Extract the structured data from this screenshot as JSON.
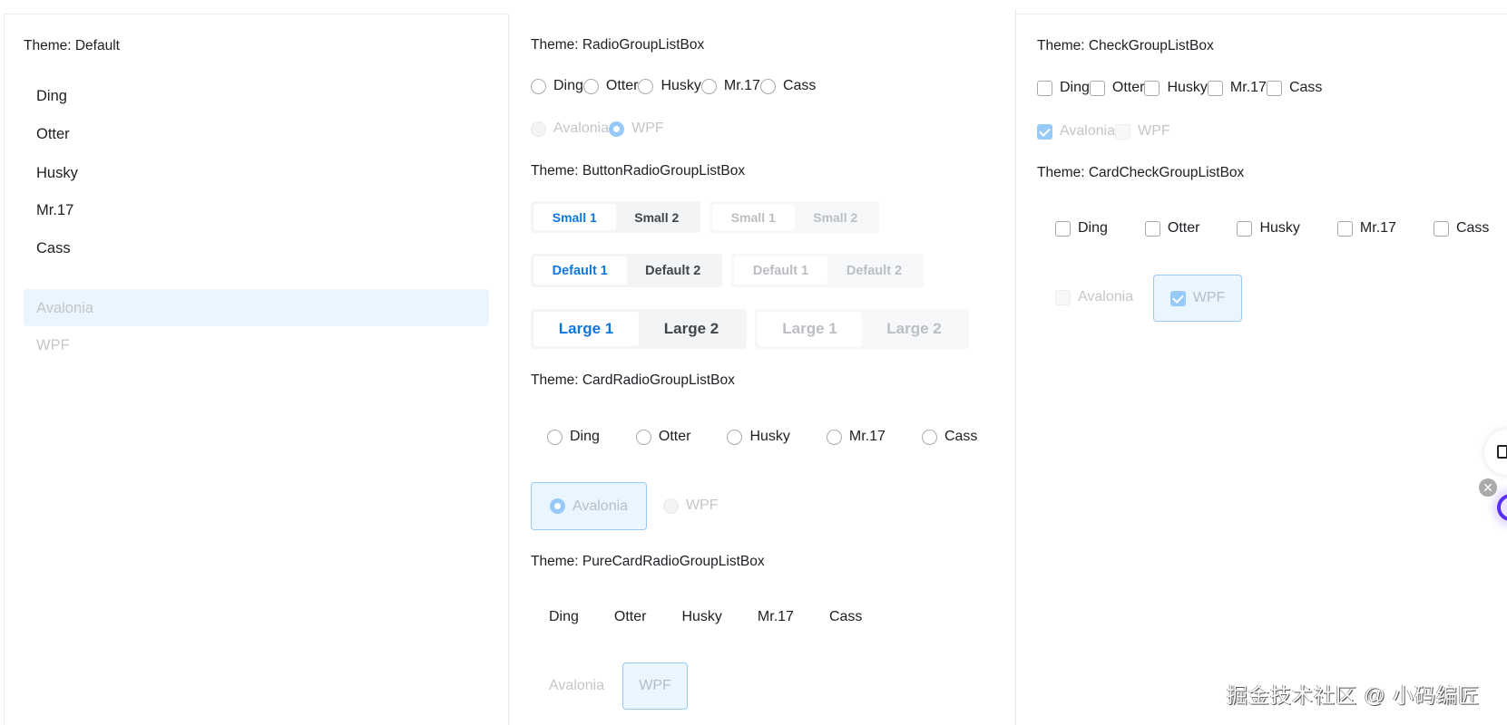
{
  "default": {
    "title": "Theme: Default",
    "items": [
      "Ding",
      "Otter",
      "Husky",
      "Mr.17",
      "Cass"
    ],
    "disabled_selected": "Avalonia",
    "disabled": "WPF"
  },
  "radio": {
    "title": "Theme: RadioGroupListBox",
    "items": [
      "Ding",
      "Otter",
      "Husky",
      "Mr.17",
      "Cass"
    ],
    "disabled": [
      "Avalonia",
      "WPF"
    ],
    "checked": "WPF"
  },
  "button_radio": {
    "title": "Theme: ButtonRadioGroupListBox",
    "small": [
      "Small 1",
      "Small 2"
    ],
    "default": [
      "Default 1",
      "Default 2"
    ],
    "large": [
      "Large 1",
      "Large 2"
    ],
    "selected_index": 0
  },
  "card_radio": {
    "title": "Theme: CardRadioGroupListBox",
    "items": [
      "Ding",
      "Otter",
      "Husky",
      "Mr.17",
      "Cass"
    ],
    "disabled": [
      "Avalonia",
      "WPF"
    ],
    "checked": "Avalonia"
  },
  "pure_card_radio": {
    "title": "Theme: PureCardRadioGroupListBox",
    "items": [
      "Ding",
      "Otter",
      "Husky",
      "Mr.17",
      "Cass"
    ],
    "disabled": [
      "Avalonia",
      "WPF"
    ],
    "selected": "WPF"
  },
  "check": {
    "title": "Theme: CheckGroupListBox",
    "items": [
      "Ding",
      "Otter",
      "Husky",
      "Mr.17",
      "Cass"
    ],
    "disabled": [
      "Avalonia",
      "WPF"
    ],
    "checked": "Avalonia"
  },
  "card_check": {
    "title": "Theme: CardCheckGroupListBox",
    "items": [
      "Ding",
      "Otter",
      "Husky",
      "Mr.17",
      "Cass"
    ],
    "disabled": [
      "Avalonia",
      "WPF"
    ],
    "checked": "WPF"
  },
  "colors": {
    "accent": "#0d77e0",
    "selected_bg": "#eaf5fe",
    "selected_border": "#97caf9"
  },
  "watermark": "掘金技术社区 @ 小码编匠"
}
